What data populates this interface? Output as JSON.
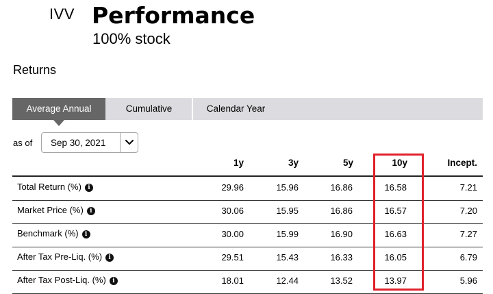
{
  "header": {
    "ticker": "IVV",
    "title": "Performance",
    "subtitle": "100% stock"
  },
  "section_title": "Returns",
  "tabs": [
    {
      "label": "Average Annual",
      "active": true
    },
    {
      "label": "Cumulative",
      "active": false
    },
    {
      "label": "Calendar Year",
      "active": false
    }
  ],
  "as_of": {
    "label": "as of",
    "selected": "Sep 30, 2021"
  },
  "table": {
    "columns": [
      "1y",
      "3y",
      "5y",
      "10y",
      "Incept."
    ],
    "rows": [
      {
        "label": "Total Return (%)",
        "values": [
          "29.96",
          "15.96",
          "16.86",
          "16.58",
          "7.21"
        ]
      },
      {
        "label": "Market Price (%)",
        "values": [
          "30.06",
          "15.95",
          "16.86",
          "16.57",
          "7.20"
        ]
      },
      {
        "label": "Benchmark (%)",
        "values": [
          "30.00",
          "15.99",
          "16.90",
          "16.63",
          "7.27"
        ]
      },
      {
        "label": "After Tax Pre-Liq. (%)",
        "values": [
          "29.51",
          "15.43",
          "16.33",
          "16.05",
          "6.79"
        ]
      },
      {
        "label": "After Tax Post-Liq. (%)",
        "values": [
          "18.01",
          "12.44",
          "13.52",
          "13.97",
          "5.96"
        ]
      }
    ]
  },
  "colors": {
    "active_tab": "#666666",
    "tab_bar": "#dcdce0",
    "highlight": "#e0202a"
  }
}
